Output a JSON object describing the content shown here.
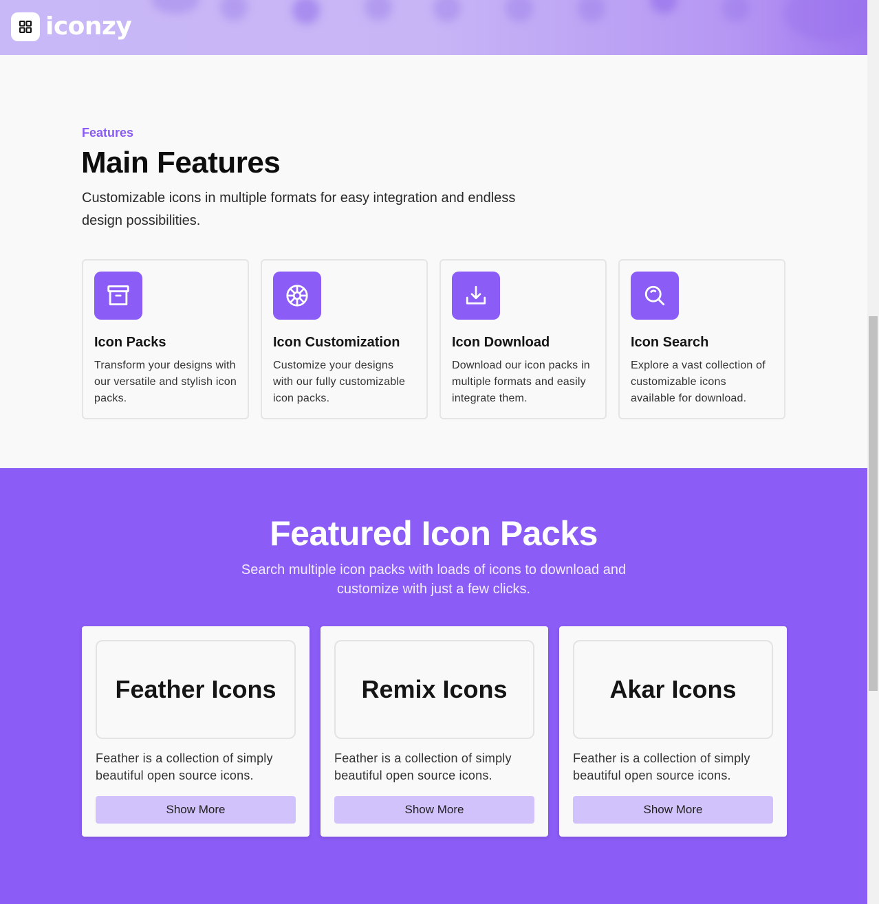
{
  "header": {
    "logo_text": "iconzy"
  },
  "features_section": {
    "eyebrow": "Features",
    "title": "Main Features",
    "subtitle": "Customizable icons in multiple formats for easy integration and endless design possibilities.",
    "cards": [
      {
        "icon": "archive-icon",
        "title": "Icon Packs",
        "description": "Transform your designs with our versatile and stylish icon packs."
      },
      {
        "icon": "aperture-icon",
        "title": "Icon Customization",
        "description": "Customize your designs with our fully customizable icon packs."
      },
      {
        "icon": "download-icon",
        "title": "Icon Download",
        "description": "Download our icon packs in multiple formats and easily integrate them."
      },
      {
        "icon": "search-icon",
        "title": "Icon Search",
        "description": "Explore a vast collection of customizable icons available for download."
      }
    ]
  },
  "packs_section": {
    "title": "Featured Icon Packs",
    "subtitle": "Search multiple icon packs with loads of icons to download and customize with just a few clicks.",
    "cards": [
      {
        "name": "Feather Icons",
        "description": "Feather is a collection of simply beautiful open source icons.",
        "button": "Show More"
      },
      {
        "name": "Remix Icons",
        "description": "Feather is a collection of simply beautiful open source icons.",
        "button": "Show More"
      },
      {
        "name": "Akar Icons",
        "description": "Feather is a collection of simply beautiful open source icons.",
        "button": "Show More"
      }
    ]
  },
  "colors": {
    "accent": "#8b5cf6",
    "button_bg": "#d1c2fb",
    "header_gradient_start": "#c9b8f7"
  }
}
